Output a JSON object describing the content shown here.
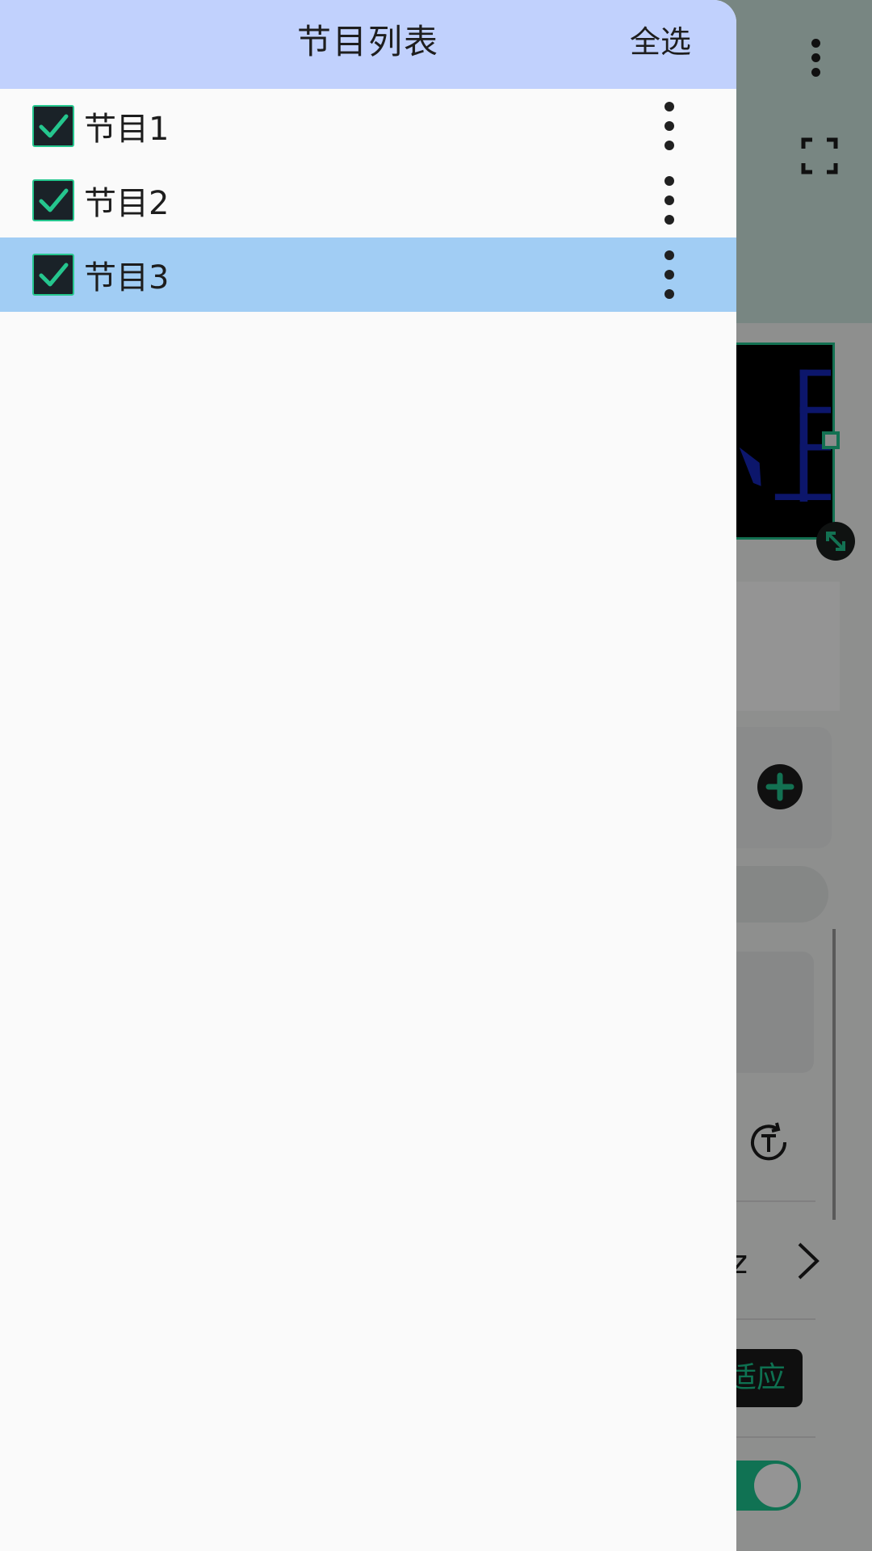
{
  "drawer": {
    "title": "节目列表",
    "select_all_label": "全选",
    "items": [
      {
        "label": "节目1",
        "checked": true,
        "selected": false
      },
      {
        "label": "节目2",
        "checked": true,
        "selected": false
      },
      {
        "label": "节目3",
        "checked": true,
        "selected": true
      }
    ]
  },
  "background": {
    "fit_button_label": "适应"
  },
  "colors": {
    "header_bg": "#c1d1fd",
    "selected_row_bg": "#a1cdf4",
    "accent_green": "#25c68e",
    "checkbox_bg": "#1a2228"
  },
  "icons": {
    "checkbox": "checkmark-icon",
    "row_menu": "more-vertical-icon",
    "top_menu": "more-vertical-icon",
    "fullscreen": "fullscreen-icon",
    "add": "plus-circle-icon",
    "rotate": "rotate-text-icon",
    "next": "chevron-right-icon",
    "resize": "resize-diagonal-icon"
  }
}
